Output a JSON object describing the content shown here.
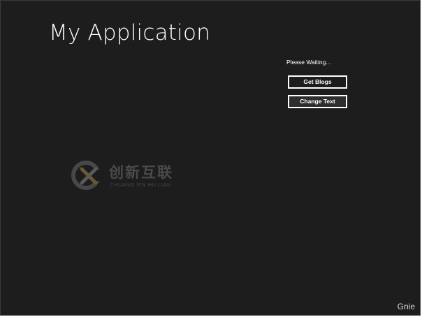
{
  "page": {
    "title": "My Application",
    "status_text": "Please Waiting..."
  },
  "buttons": {
    "get_blogs": "Get Blogs",
    "change_text": "Change Text"
  },
  "watermark": {
    "chinese": "创新互联",
    "english": "CHUANG XIN HU LIAN",
    "icon": "x-logo-icon"
  },
  "credit": {
    "text": "Gnie"
  },
  "colors": {
    "background": "#1d1d1d",
    "text": "#ffffff",
    "button_border": "#ffffff",
    "watermark_accent": "#a88a3a"
  }
}
